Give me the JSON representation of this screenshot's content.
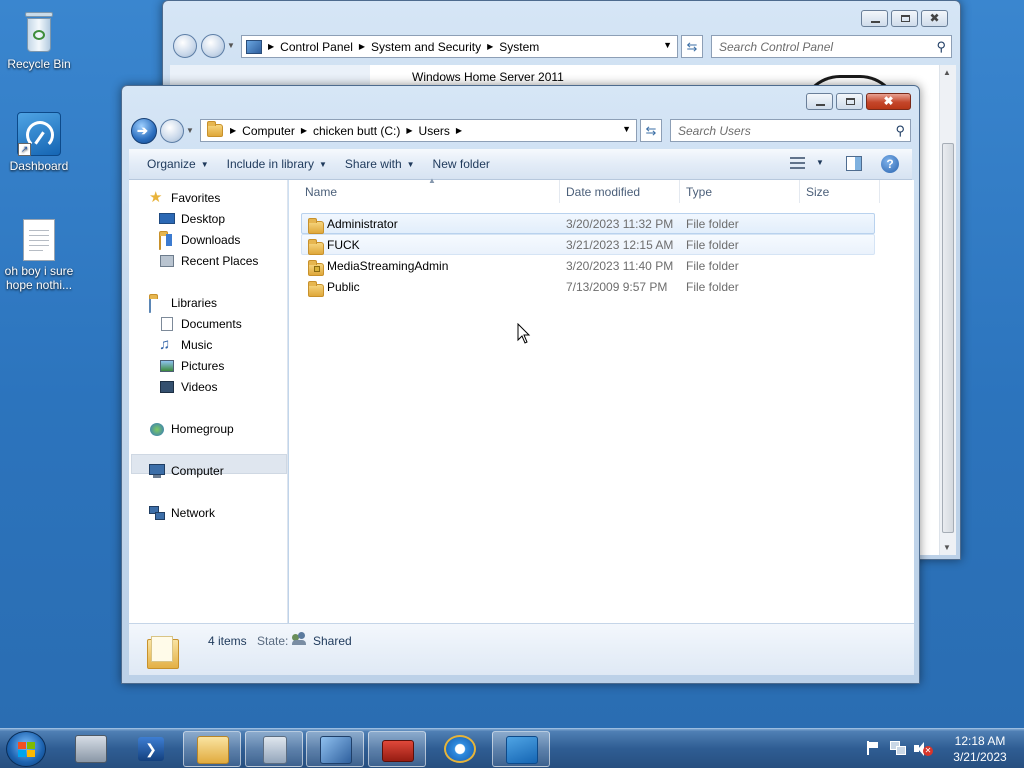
{
  "desktop": {
    "icons": [
      {
        "label": "Recycle Bin",
        "icon": "recycle-bin-icon"
      },
      {
        "label": "Dashboard",
        "icon": "dashboard-icon"
      },
      {
        "label": "oh boy i sure hope nothi...",
        "icon": "text-file-icon"
      }
    ]
  },
  "back_window": {
    "breadcrumb": [
      "Control Panel",
      "System and Security",
      "System"
    ],
    "search_placeholder": "Search Control Panel",
    "visible_text": "Windows Home Server 2011"
  },
  "explorer": {
    "breadcrumb": [
      "Computer",
      "chicken butt (C:)",
      "Users"
    ],
    "search_placeholder": "Search Users",
    "toolbar": {
      "organize": "Organize",
      "include": "Include in library",
      "share": "Share with",
      "new_folder": "New folder"
    },
    "nav": {
      "favorites": "Favorites",
      "desktop": "Desktop",
      "downloads": "Downloads",
      "recent": "Recent Places",
      "libraries": "Libraries",
      "documents": "Documents",
      "music": "Music",
      "pictures": "Pictures",
      "videos": "Videos",
      "homegroup": "Homegroup",
      "computer": "Computer",
      "network": "Network"
    },
    "columns": {
      "name": "Name",
      "date": "Date modified",
      "type": "Type",
      "size": "Size"
    },
    "rows": [
      {
        "name": "Administrator",
        "date": "3/20/2023 11:32 PM",
        "type": "File folder",
        "size": ""
      },
      {
        "name": "FUCK",
        "date": "3/21/2023 12:15 AM",
        "type": "File folder",
        "size": ""
      },
      {
        "name": "MediaStreamingAdmin",
        "date": "3/20/2023 11:40 PM",
        "type": "File folder",
        "size": ""
      },
      {
        "name": "Public",
        "date": "7/13/2009 9:57 PM",
        "type": "File folder",
        "size": ""
      }
    ],
    "details": {
      "count": "4 items",
      "state_label": "State:",
      "state_value": "Shared"
    }
  },
  "taskbar": {
    "time": "12:18 AM",
    "date": "3/21/2023"
  },
  "colors": {
    "desktop": "#2f76be",
    "selection_border": "#b9d2ee",
    "close_button": "#c5462b"
  }
}
